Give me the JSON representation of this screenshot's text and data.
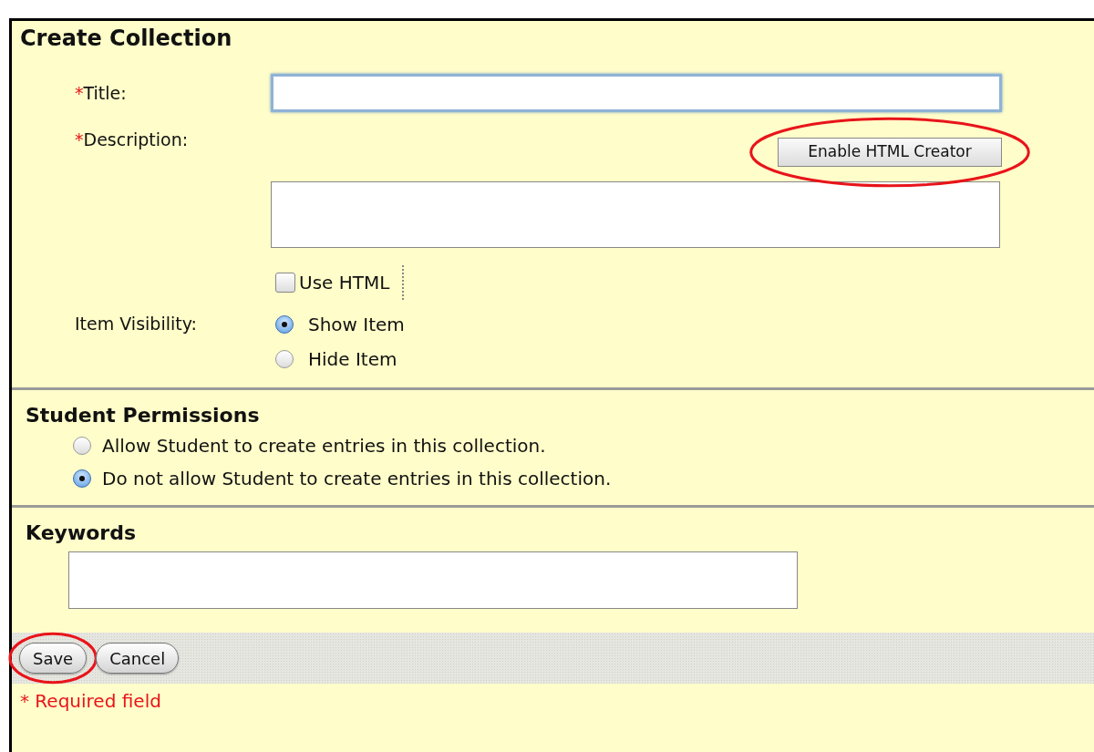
{
  "heading": "Create Collection",
  "title_field": {
    "marker": "*",
    "label": "Title:",
    "focused": true
  },
  "description_field": {
    "marker": "*",
    "label": "Description:",
    "button": {
      "label": "Enable HTML Creator",
      "highlighted": true
    }
  },
  "use_html": {
    "label": "Use HTML",
    "checked": false
  },
  "item_visibility": {
    "label": "Item Visibility:",
    "options": [
      {
        "label": "Show Item",
        "selected": true
      },
      {
        "label": "Hide Item",
        "selected": false
      }
    ]
  },
  "student_permissions": {
    "heading": "Student Permissions",
    "options": [
      {
        "label": "Allow Student to create entries in this collection.",
        "selected": false
      },
      {
        "label": "Do not allow Student to create entries in this collection.",
        "selected": true
      }
    ]
  },
  "keywords": {
    "heading": "Keywords"
  },
  "buttons": [
    {
      "label": "Save",
      "highlighted": true
    },
    {
      "label": "Cancel",
      "highlighted": false
    }
  ],
  "footnote": "* Required field"
}
